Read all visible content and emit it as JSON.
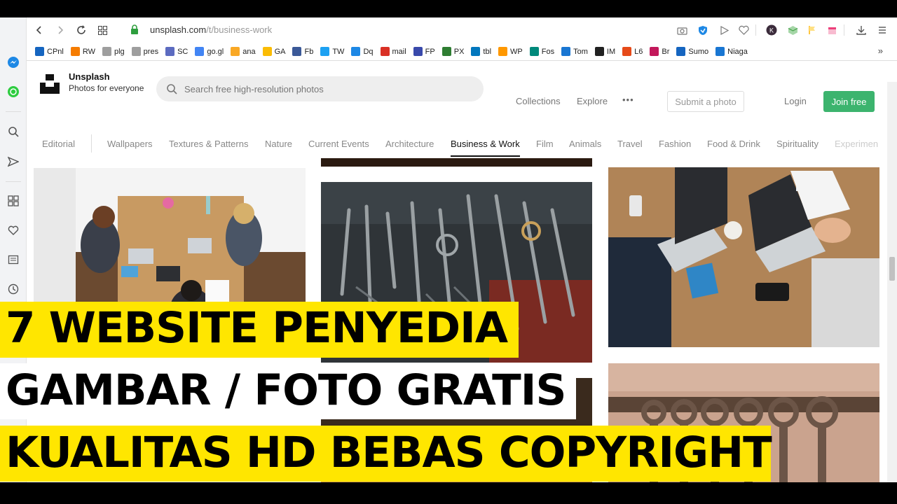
{
  "browser": {
    "url_host": "unsplash.com",
    "url_path": "/t/business-work",
    "bookmarks": [
      {
        "label": "CPnl",
        "color": "#1565c0",
        "icon": "cpanel-icon"
      },
      {
        "label": "RW",
        "color": "#f57c00",
        "icon": "blogger-icon"
      },
      {
        "label": "plg",
        "color": "#9e9e9e",
        "icon": "sst-icon"
      },
      {
        "label": "pres",
        "color": "#9e9e9e",
        "icon": "sst-icon"
      },
      {
        "label": "SC",
        "color": "#5c6bc0",
        "icon": "search-console-icon"
      },
      {
        "label": "go.gl",
        "color": "#4285f4",
        "icon": "google-icon"
      },
      {
        "label": "ana",
        "color": "#f9a825",
        "icon": "analytics-icon"
      },
      {
        "label": "GA",
        "color": "#fbbc05",
        "icon": "adsense-icon"
      },
      {
        "label": "Fb",
        "color": "#3b5998",
        "icon": "facebook-icon"
      },
      {
        "label": "TW",
        "color": "#1da1f2",
        "icon": "twitter-icon"
      },
      {
        "label": "Dq",
        "color": "#1e88e5",
        "icon": "docs-icon"
      },
      {
        "label": "mail",
        "color": "#d93025",
        "icon": "gmail-icon"
      },
      {
        "label": "FP",
        "color": "#3949ab",
        "icon": "fanpage-icon"
      },
      {
        "label": "PX",
        "color": "#2e7d32",
        "icon": "pixabay-icon"
      },
      {
        "label": "tbl",
        "color": "#0277bd",
        "icon": "table-icon"
      },
      {
        "label": "WP",
        "color": "#ff9800",
        "icon": "wordpress-icon"
      },
      {
        "label": "Fos",
        "color": "#00897b",
        "icon": "fos-icon"
      },
      {
        "label": "Tom",
        "color": "#1976d2",
        "icon": "tumblr-icon"
      },
      {
        "label": "IM",
        "color": "#212121",
        "icon": "im-icon"
      },
      {
        "label": "L6",
        "color": "#e64a19",
        "icon": "l6-icon"
      },
      {
        "label": "Br",
        "color": "#c2185b",
        "icon": "br-icon"
      },
      {
        "label": "Sumo",
        "color": "#1565c0",
        "icon": "sumo-icon"
      },
      {
        "label": "Niaga",
        "color": "#1976d2",
        "icon": "niaga-icon"
      }
    ],
    "more": "»"
  },
  "unsplash": {
    "brand_name": "Unsplash",
    "tagline": "Photos for everyone",
    "search_placeholder": "Search free high-resolution photos",
    "nav": {
      "collections": "Collections",
      "explore": "Explore",
      "more": "•••",
      "submit": "Submit a photo",
      "login": "Login",
      "join": "Join free"
    },
    "categories": [
      "Editorial",
      "Wallpapers",
      "Textures & Patterns",
      "Nature",
      "Current Events",
      "Architecture",
      "Business & Work",
      "Film",
      "Animals",
      "Travel",
      "Fashion",
      "Food & Drink",
      "Spirituality",
      "Experimen"
    ],
    "active_category": "Business & Work",
    "accent": "#3cb46e"
  },
  "caption": {
    "line1": "7 WEBSITE PENYEDIA",
    "line2": "GAMBAR / FOTO GRATIS",
    "line3": "KUALITAS HD BEBAS COPYRIGHT",
    "highlight": "#ffe600"
  }
}
